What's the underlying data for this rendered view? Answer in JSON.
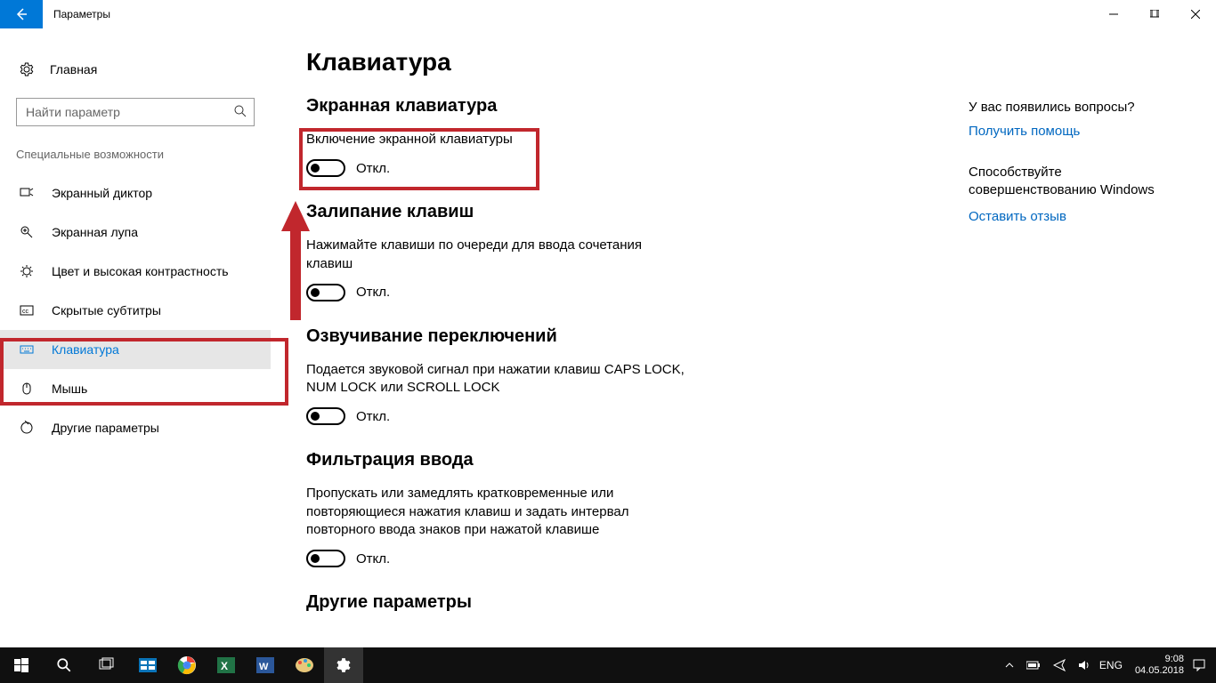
{
  "titlebar": {
    "title": "Параметры"
  },
  "sidebar": {
    "home": "Главная",
    "search_placeholder": "Найти параметр",
    "section": "Специальные возможности",
    "items": [
      {
        "label": "Экранный диктор"
      },
      {
        "label": "Экранная лупа"
      },
      {
        "label": "Цвет и высокая контрастность"
      },
      {
        "label": "Скрытые субтитры"
      },
      {
        "label": "Клавиатура"
      },
      {
        "label": "Мышь"
      },
      {
        "label": "Другие параметры"
      }
    ]
  },
  "main": {
    "title": "Клавиатура",
    "s1": {
      "heading": "Экранная клавиатура",
      "label": "Включение экранной клавиатуры",
      "state": "Откл."
    },
    "s2": {
      "heading": "Залипание клавиш",
      "label": "Нажимайте клавиши по очереди для ввода сочетания клавиш",
      "state": "Откл."
    },
    "s3": {
      "heading": "Озвучивание переключений",
      "label": "Подается звуковой сигнал при нажатии клавиш CAPS LOCK, NUM LOCK или SCROLL LOCK",
      "state": "Откл."
    },
    "s4": {
      "heading": "Фильтрация ввода",
      "label": "Пропускать или замедлять кратковременные или повторяющиеся нажатия клавиш и задать интервал повторного ввода знаков при нажатой клавише",
      "state": "Откл."
    },
    "s5": {
      "heading": "Другие параметры"
    }
  },
  "right": {
    "q_heading": "У вас появились вопросы?",
    "q_link": "Получить помощь",
    "f_heading": "Способствуйте совершенствованию Windows",
    "f_link": "Оставить отзыв"
  },
  "taskbar": {
    "lang": "ENG",
    "time": "9:08",
    "date": "04.05.2018"
  }
}
